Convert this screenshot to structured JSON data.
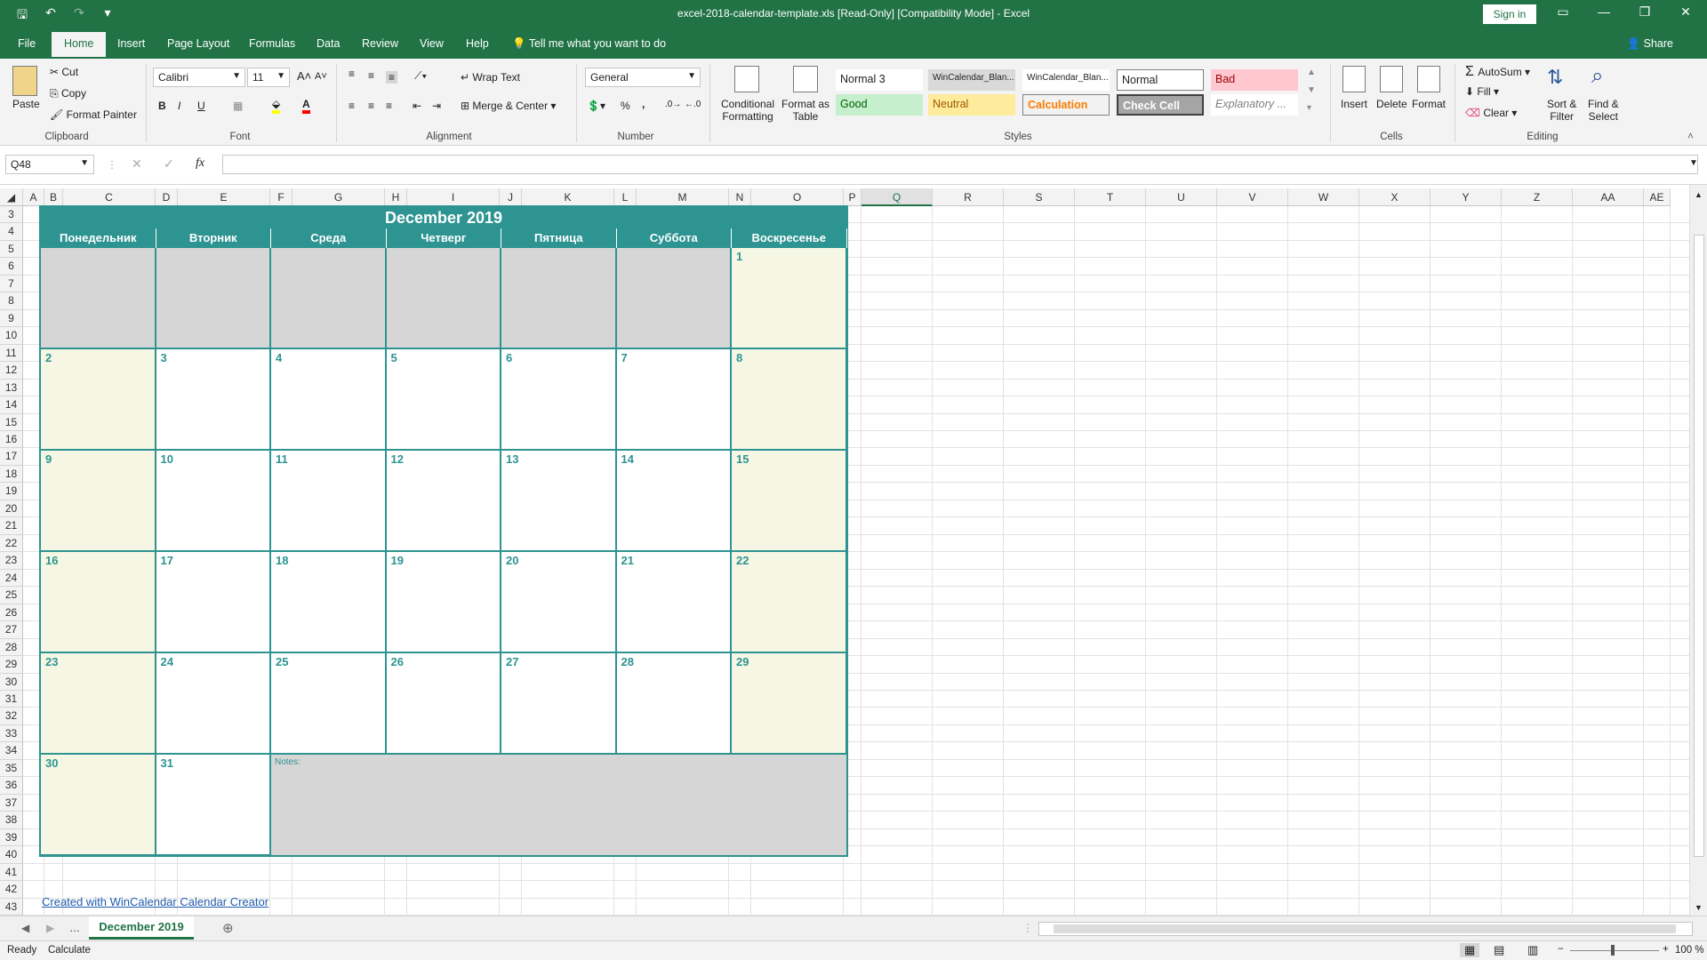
{
  "window": {
    "title": "excel-2018-calendar-template.xls  [Read-Only]  [Compatibility Mode]  -  Excel",
    "signin": "Sign in",
    "share": "Share",
    "tell_me": "Tell me what you want to do"
  },
  "tabs": [
    "File",
    "Home",
    "Insert",
    "Page Layout",
    "Formulas",
    "Data",
    "Review",
    "View",
    "Help"
  ],
  "ribbon": {
    "clipboard": {
      "paste": "Paste",
      "cut": "Cut",
      "copy": "Copy",
      "format_painter": "Format Painter",
      "label": "Clipboard"
    },
    "font": {
      "name": "Calibri",
      "size": "11",
      "label": "Font",
      "bold": "B",
      "italic": "I",
      "underline": "U"
    },
    "alignment": {
      "wrap": "Wrap Text",
      "merge": "Merge & Center",
      "label": "Alignment"
    },
    "number": {
      "format": "General",
      "percent": "%",
      "comma": ",",
      "label": "Number"
    },
    "styles": {
      "conditional": "Conditional",
      "formatting": "Formatting",
      "format_as": "Format as",
      "table": "Table",
      "label": "Styles",
      "gallery": [
        {
          "text": "Normal 3",
          "bg": "#ffffff",
          "fg": "#222222"
        },
        {
          "text": "WinCalendar_Blan...",
          "bg": "#d9d9d9",
          "fg": "#222222"
        },
        {
          "text": "WinCalendar_Blan...",
          "bg": "#ffffff",
          "fg": "#222222"
        },
        {
          "text": "Normal",
          "bg": "#ffffff",
          "fg": "#222222"
        },
        {
          "text": "Bad",
          "bg": "#ffc7ce",
          "fg": "#9c0006"
        },
        {
          "text": "Good",
          "bg": "#c6efce",
          "fg": "#006100"
        },
        {
          "text": "Neutral",
          "bg": "#ffeb9c",
          "fg": "#9c5700"
        },
        {
          "text": "Calculation",
          "bg": "#f2f2f2",
          "fg": "#fa7d00"
        },
        {
          "text": "Check Cell",
          "bg": "#a5a5a5",
          "fg": "#ffffff"
        },
        {
          "text": "Explanatory ...",
          "bg": "#ffffff",
          "fg": "#7f7f7f"
        }
      ]
    },
    "cells": {
      "insert": "Insert",
      "delete": "Delete",
      "format": "Format",
      "label": "Cells"
    },
    "editing": {
      "autosum": "AutoSum",
      "fill": "Fill",
      "clear": "Clear",
      "sort": "Sort &",
      "filter": "Filter",
      "find": "Find &",
      "select": "Select",
      "label": "Editing"
    }
  },
  "formula_bar": {
    "name_box": "Q48",
    "fx": "fx",
    "value": ""
  },
  "columns": [
    "A",
    "B",
    "C",
    "D",
    "E",
    "F",
    "G",
    "H",
    "I",
    "J",
    "K",
    "L",
    "M",
    "N",
    "O",
    "P",
    "Q",
    "R",
    "S",
    "T",
    "U",
    "V",
    "W",
    "X",
    "Y",
    "Z",
    "AA",
    "AE"
  ],
  "rows": [
    "3",
    "4",
    "5",
    "6",
    "7",
    "8",
    "9",
    "10",
    "11",
    "12",
    "13",
    "14",
    "15",
    "16",
    "17",
    "18",
    "19",
    "20",
    "21",
    "22",
    "23",
    "24",
    "25",
    "26",
    "27",
    "28",
    "29",
    "30",
    "31",
    "32",
    "33",
    "34",
    "35",
    "36",
    "37",
    "38",
    "39",
    "40",
    "41",
    "42",
    "43"
  ],
  "calendar": {
    "title": "December 2019",
    "weekdays": [
      "Понедельник",
      "Вторник",
      "Среда",
      "Четверг",
      "Пятница",
      "Суббота",
      "Воскресенье"
    ],
    "weeks": [
      [
        "",
        "",
        "",
        "",
        "",
        "",
        "1"
      ],
      [
        "2",
        "3",
        "4",
        "5",
        "6",
        "7",
        "8"
      ],
      [
        "9",
        "10",
        "11",
        "12",
        "13",
        "14",
        "15"
      ],
      [
        "16",
        "17",
        "18",
        "19",
        "20",
        "21",
        "22"
      ],
      [
        "23",
        "24",
        "25",
        "26",
        "27",
        "28",
        "29"
      ],
      [
        "30",
        "31"
      ]
    ],
    "notes_label": "Notes:",
    "colors": {
      "teal": "#2d9491",
      "weekend": "#f5f7e4",
      "blank": "#d6d6d6"
    }
  },
  "footer_link": "Created with WinCalendar Calendar Creator",
  "sheet_tab": "December 2019",
  "status": {
    "ready": "Ready",
    "calculate": "Calculate",
    "zoom": "100 %"
  }
}
